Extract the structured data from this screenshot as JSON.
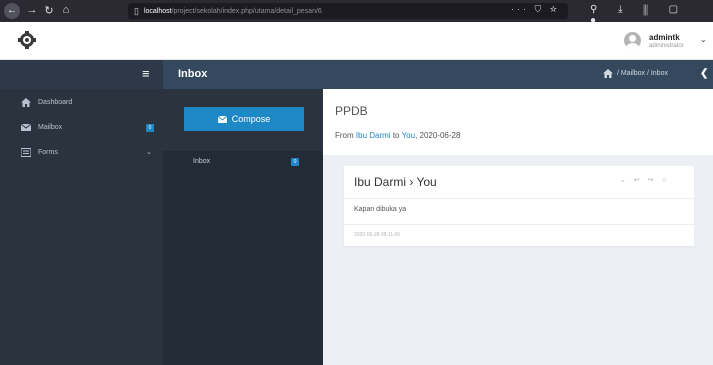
{
  "browser": {
    "url_host": "localhost",
    "url_path": "/project/sekolah/index.php/utama/detail_pesan/6",
    "url_actions": "··· ⛉ ☆",
    "toolbar_right": "⚲ ⤓ ⫼ ▢ ●"
  },
  "header": {
    "user_name": "admintk",
    "user_role": "administrator"
  },
  "sidebar": {
    "items": [
      {
        "label": "Dashboard",
        "icon": "home-icon"
      },
      {
        "label": "Mailbox",
        "icon": "envelope-icon",
        "badge": "0"
      },
      {
        "label": "Forms",
        "icon": "list-icon"
      }
    ]
  },
  "topbar": {
    "title": "Inbox",
    "breadcrumb": "/ Mailbox / Inbox"
  },
  "mailbox": {
    "compose_label": "Compose",
    "inbox_label": "Inbox",
    "inbox_badge": "0"
  },
  "message": {
    "subject": "PPDB",
    "from_prefix": "From",
    "from_name": "Ibu Darmi",
    "to_word": "to",
    "to_name": "You",
    "date_suffix": ", 2020-06-28",
    "card_title": "Ibu Darmi  ›  You",
    "body": "Kapan dibuka ya",
    "timestamp": "2020-06-28 08:11:06"
  },
  "colors": {
    "accent": "#1e88c6",
    "sidebar_bg": "#2b333e",
    "topbar_bg": "#34495e"
  }
}
